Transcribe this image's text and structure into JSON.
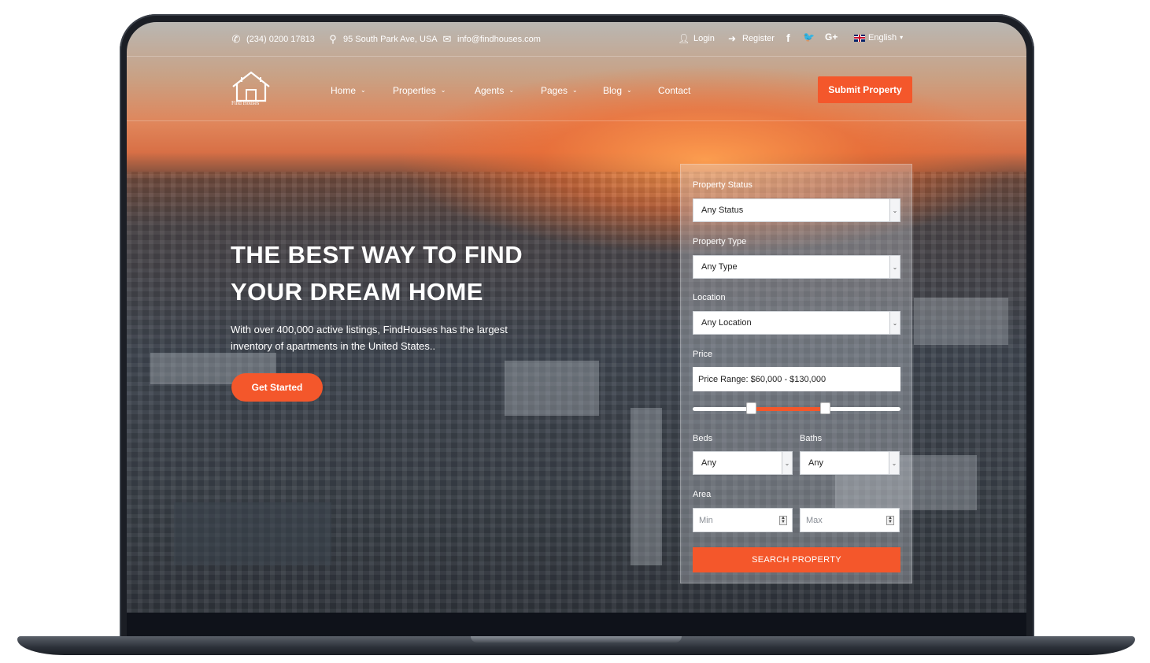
{
  "topbar": {
    "phone": "(234) 0200 17813",
    "address": "95 South Park Ave, USA",
    "email": "info@findhouses.com",
    "login": "Login",
    "register": "Register",
    "social": {
      "facebook": "f",
      "twitter": "🐦",
      "google": "G+"
    },
    "language": "English"
  },
  "brand": {
    "logo_text": "Find Houses"
  },
  "nav": {
    "items": [
      {
        "label": "Home",
        "dropdown": true
      },
      {
        "label": "Properties",
        "dropdown": true
      },
      {
        "label": "Agents",
        "dropdown": true
      },
      {
        "label": "Pages",
        "dropdown": true
      },
      {
        "label": "Blog",
        "dropdown": true
      },
      {
        "label": "Contact",
        "dropdown": false
      }
    ],
    "submit_label": "Submit Property"
  },
  "hero": {
    "title_line1": "THE BEST WAY TO FIND",
    "title_line2": "YOUR DREAM HOME",
    "subtitle": "With over 400,000 active listings, FindHouses has the largest inventory of apartments in the United States..",
    "cta": "Get Started"
  },
  "search": {
    "status_label": "Property Status",
    "status_value": "Any Status",
    "type_label": "Property Type",
    "type_value": "Any Type",
    "location_label": "Location",
    "location_value": "Any Location",
    "price_label": "Price",
    "price_value": "Price Range: $60,000 - $130,000",
    "price_range": {
      "min": 60000,
      "max": 130000
    },
    "beds_label": "Beds",
    "beds_value": "Any",
    "baths_label": "Baths",
    "baths_value": "Any",
    "area_label": "Area",
    "area_min_placeholder": "Min",
    "area_max_placeholder": "Max",
    "submit_label": "SEARCH PROPERTY"
  },
  "colors": {
    "accent": "#f4572b",
    "bezel": "#1b1e25"
  }
}
